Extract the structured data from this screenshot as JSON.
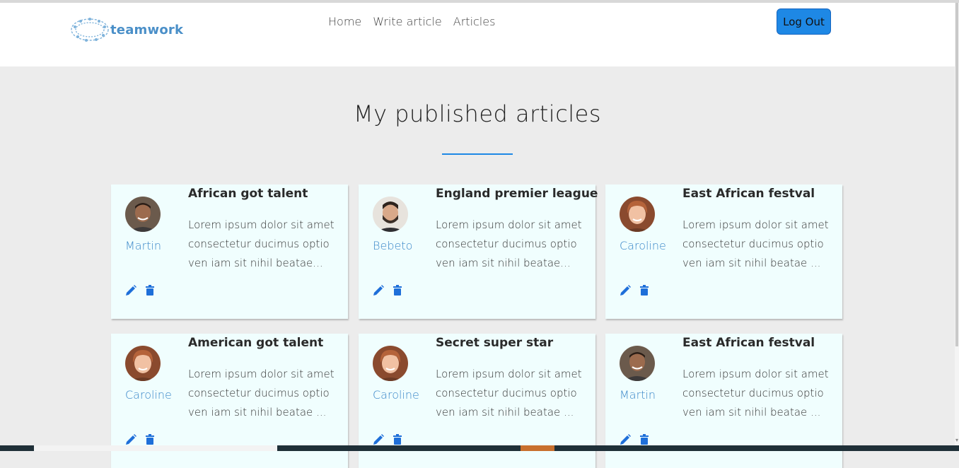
{
  "brand": {
    "logo_text": "teamwork"
  },
  "nav": {
    "links": [
      "Home",
      "Write article",
      "Articles"
    ],
    "logout_label": "Log Out"
  },
  "main": {
    "title": "My published articles"
  },
  "articles": [
    {
      "title": "African got talent",
      "author": "Martin",
      "body": [
        "Lorem ipsum dolor sit amet",
        "consectetur ducimus optio",
        "ven iam sit nihil beatae..."
      ],
      "avatar": "man-smiling"
    },
    {
      "title": "England premier league",
      "author": "Bebeto",
      "body": [
        "Lorem ipsum dolor sit amet",
        "consectetur ducimus optio",
        "ven iam sit nihil beatae..."
      ],
      "avatar": "man-beard"
    },
    {
      "title": "East African festval",
      "author": "Caroline",
      "body": [
        "Lorem ipsum dolor sit amet",
        "consectetur ducimus optio",
        "ven iam sit nihil beatae ..."
      ],
      "avatar": "woman"
    },
    {
      "title": "American got talent",
      "author": "Caroline",
      "body": [
        "Lorem ipsum dolor sit amet",
        "consectetur ducimus optio",
        "ven iam sit nihil beatae ..."
      ],
      "avatar": "woman"
    },
    {
      "title": "Secret super star",
      "author": "Caroline",
      "body": [
        "Lorem ipsum dolor sit amet",
        "consectetur ducimus optio",
        "ven iam sit nihil beatae ..."
      ],
      "avatar": "woman"
    },
    {
      "title": "East African festval",
      "author": "Martin",
      "body": [
        "Lorem ipsum dolor sit amet",
        "consectetur ducimus optio",
        "ven iam sit nihil beatae ..."
      ],
      "avatar": "man-smiling"
    }
  ],
  "colors": {
    "accent": "#1e88e5",
    "author_link": "#3a87c9",
    "card_background": "#f0fefe",
    "page_background": "#ececec"
  },
  "icons": {
    "edit": "pencil-icon",
    "delete": "trash-icon"
  }
}
